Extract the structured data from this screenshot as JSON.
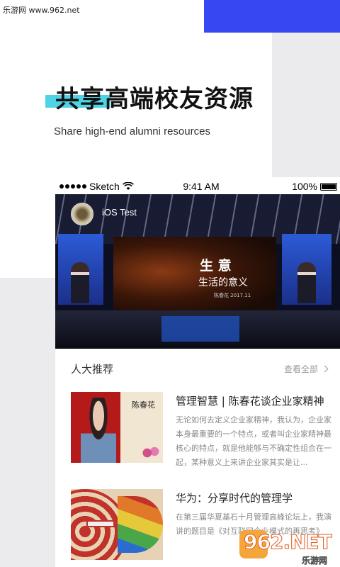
{
  "watermark_top": "乐游网 www.962.net",
  "hero": {
    "title": "共享高端校友资源",
    "subtitle": "Share high-end alumni resources"
  },
  "status_bar": {
    "carrier": "Sketch",
    "time": "9:41 AM",
    "battery": "100%"
  },
  "banner": {
    "label": "iOS Test",
    "screen_title": "生 意",
    "screen_subtitle": "生活的意义",
    "screen_caption": "陈春花 2017.11"
  },
  "section": {
    "title": "人大推荐",
    "view_all": "查看全部"
  },
  "articles": [
    {
      "title": "管理智慧 | 陈春花谈企业家精神",
      "body": "无论如何去定义企业家精神，我认为，企业家本身最重要的一个特点，或者叫企业家精神最核心的特点，就是他能够与不确定性组合在一起，某种意义上来讲企业家其实是让...",
      "thumb_caption": "陈春花"
    },
    {
      "title": "华为：分享时代的管理学",
      "body": "在第三届华夏基石十月管理高峰论坛上，我演讲的题目是《对互联网企业模式的再思考》"
    }
  ],
  "watermark_bottom": {
    "main": "962.NET",
    "sub": "乐游网"
  }
}
